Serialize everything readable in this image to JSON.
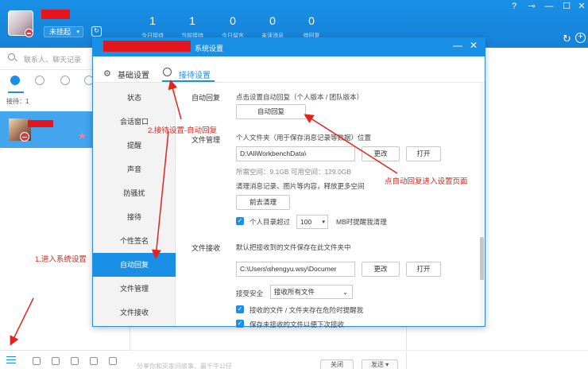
{
  "header": {
    "status_label": "未挂起",
    "status_caret": "▾",
    "stats": [
      {
        "value": "1",
        "label": "今日接待"
      },
      {
        "value": "1",
        "label": "当前接待"
      },
      {
        "value": "0",
        "label": "今日留言"
      },
      {
        "value": "0",
        "label": "未读消息"
      },
      {
        "value": "0",
        "label": "待回复"
      }
    ],
    "window_buttons": [
      "?",
      "⊸",
      "—",
      "☐",
      "✕"
    ]
  },
  "left_panel": {
    "search_placeholder": "联系人、聊天记录",
    "reception_label": "接待：1",
    "star": "★"
  },
  "chat": {
    "hint": "分享你和买家间故事，赢千牛公仔",
    "close_label": "关闭",
    "send_label": "发送 ▾"
  },
  "dialog": {
    "title": "系统设置",
    "min": "—",
    "close": "✕",
    "tabs": [
      {
        "label": "基础设置",
        "icon": "⚙"
      },
      {
        "label": "接待设置"
      }
    ],
    "nav": [
      "状态",
      "会话窗口",
      "提醒",
      "声音",
      "防骚扰",
      "接待",
      "个性签名",
      "自动回复",
      "文件管理",
      "文件接收"
    ],
    "active_nav": "自动回复",
    "auto_reply": {
      "section": "自动回复",
      "desc": "点击设置自动回复（个人版本 / 团队版本）",
      "button": "自动回复"
    },
    "file_mgmt": {
      "section": "文件管理",
      "desc": "个人文件夹（用于保存消息记录等数据）位置",
      "path": "D:\\AliWorkbenchData\\",
      "change": "更改",
      "open": "打开",
      "space": "所需空间：9.1GB   可用空间：129.0GB",
      "clean_desc": "清理消息记录、图片等内容，释放更多空间",
      "clean_btn": "前去清理",
      "limit_prefix": "个人目录超过",
      "limit_value": "100",
      "limit_suffix": "MB时提醒我清理"
    },
    "file_recv": {
      "section": "文件接收",
      "desc": "默认把接收到的文件保存在此文件夹中",
      "path": "C:\\Users\\shengyu.wsy\\Documer",
      "change": "更改",
      "open": "打开",
      "security_label": "接受安全",
      "security_value": "接收所有文件",
      "check1": "接收的文件 / 文件夹存在危险时提醒我",
      "check2": "保存未接收的文件以便下次接收"
    }
  },
  "annotations": {
    "step1": "1.进入系统设置",
    "step2": "2.接待设置-自动回复",
    "step3": "点自动回复进入设置页面"
  },
  "colors": {
    "brand_blue": "#1a8fe6",
    "annotation_red": "#e5231b",
    "redaction_red": "#e2161c"
  }
}
